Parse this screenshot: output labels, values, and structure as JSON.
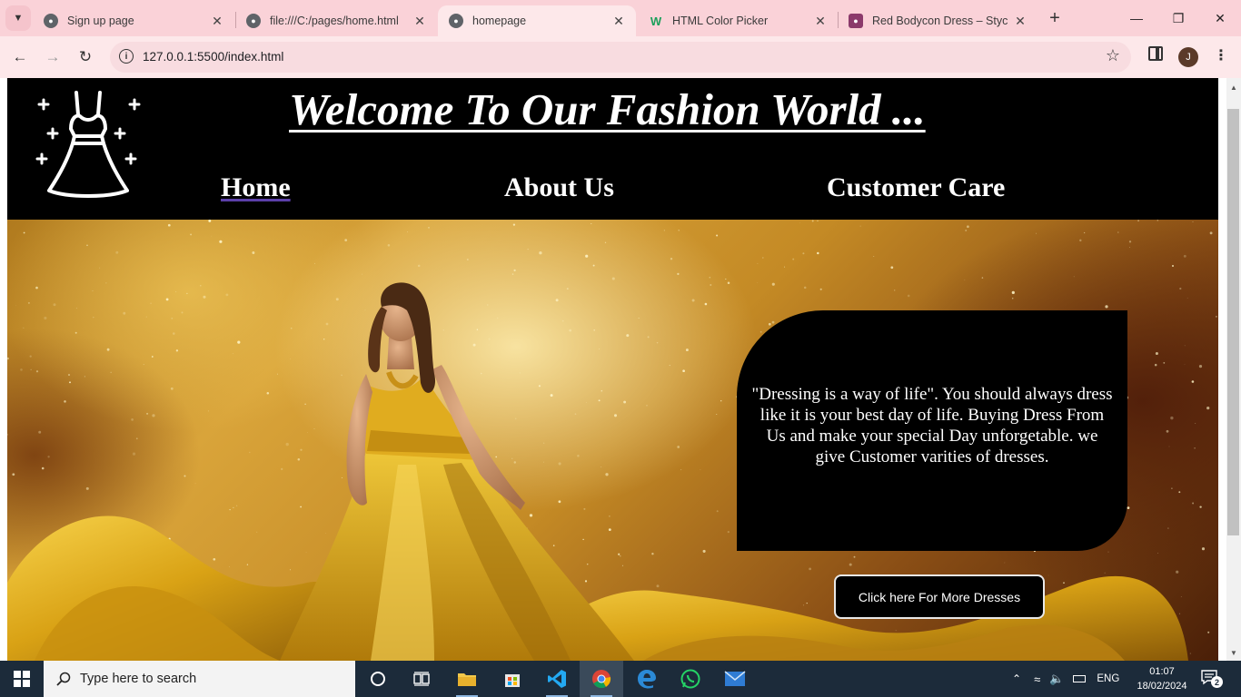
{
  "browser": {
    "tabs": [
      {
        "title": "Sign up page",
        "favicon": "globe-icon",
        "active": false
      },
      {
        "title": "file:///C:/pages/home.html",
        "favicon": "globe-icon",
        "active": false
      },
      {
        "title": "homepage",
        "favicon": "globe-icon",
        "active": true
      },
      {
        "title": "HTML Color Picker",
        "favicon": "w3schools-icon",
        "active": false
      },
      {
        "title": "Red Bodycon Dress – Styche",
        "favicon": "store-icon",
        "active": false
      }
    ],
    "url": "127.0.0.1:5500/index.html",
    "profile_initial": "J"
  },
  "site": {
    "title": "Welcome To Our Fashion World ...",
    "nav": [
      {
        "label": "Home",
        "current": true
      },
      {
        "label": "About Us",
        "current": false
      },
      {
        "label": "Customer Care",
        "current": false
      }
    ],
    "quote": "\"Dressing is a way of life\". You should always dress like it is your best day of life. Buying Dress From Us and make your special Day unforgetable. we give Customer varities of dresses.",
    "cta_label": "Click here For More Dresses"
  },
  "taskbar": {
    "search_placeholder": "Type here to search",
    "language": "ENG",
    "time": "01:07",
    "date": "18/02/2024",
    "notification_count": "2"
  },
  "colors": {
    "header_bg": "#000000",
    "tab_strip": "#fad2d8",
    "taskbar": "#1c2b3a",
    "nav_underline": "#5b3fa8"
  }
}
